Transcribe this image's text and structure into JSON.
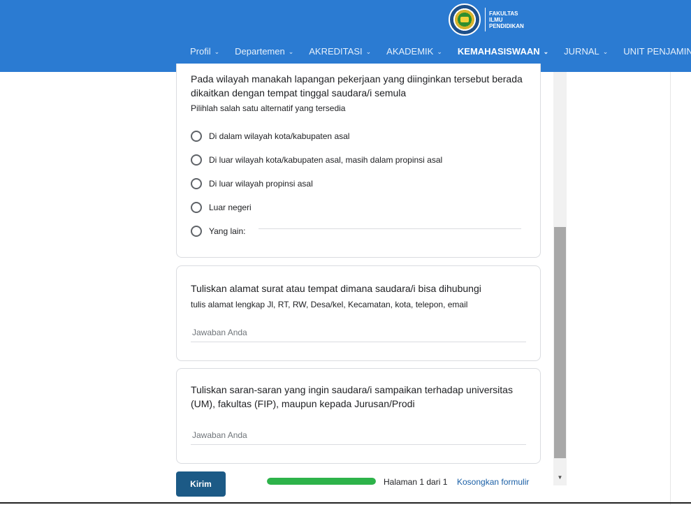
{
  "header": {
    "logo_lines": [
      "FAKULTAS",
      "ILMU",
      "PENDIDIKAN"
    ],
    "logo_emblem_text": "UM",
    "nav": [
      {
        "label": "Profil",
        "active": false
      },
      {
        "label": "Departemen",
        "active": false
      },
      {
        "label": "AKREDITASI",
        "active": false
      },
      {
        "label": "AKADEMIK",
        "active": false
      },
      {
        "label": "KEMAHASISWAAN",
        "active": true
      },
      {
        "label": "JURNAL",
        "active": false
      },
      {
        "label": "UNIT PENJAMINAN",
        "active": false
      }
    ]
  },
  "questions": {
    "q1": {
      "title": "Pada wilayah manakah lapangan pekerjaan yang diinginkan tersebut berada dikaitkan dengan tempat tinggal saudara/i semula",
      "subtitle": "Pilihlah salah satu alternatif yang tersedia",
      "options": [
        "Di dalam wilayah kota/kabupaten asal",
        "Di luar wilayah kota/kabupaten asal, masih dalam propinsi asal",
        "Di luar wilayah propinsi asal",
        "Luar negeri",
        "Yang lain:"
      ]
    },
    "q2": {
      "title": "Tuliskan alamat surat atau tempat dimana saudara/i bisa dihubungi",
      "subtitle": "tulis alamat lengkap Jl, RT, RW, Desa/kel, Kecamatan, kota, telepon, email",
      "placeholder": "Jawaban Anda"
    },
    "q3": {
      "title": "Tuliskan saran-saran yang ingin saudara/i sampaikan terhadap universitas (UM), fakultas (FIP), maupun kepada Jurusan/Prodi",
      "placeholder": "Jawaban Anda"
    }
  },
  "footer": {
    "submit_label": "Kirim",
    "progress": 1.0,
    "page_indicator": "Halaman 1 dari 1",
    "clear_label": "Kosongkan formulir"
  },
  "colors": {
    "header_bg": "#2b7bd2",
    "submit_bg": "#1c5a86",
    "progress": "#2db34a",
    "link": "#1a5fa6"
  }
}
